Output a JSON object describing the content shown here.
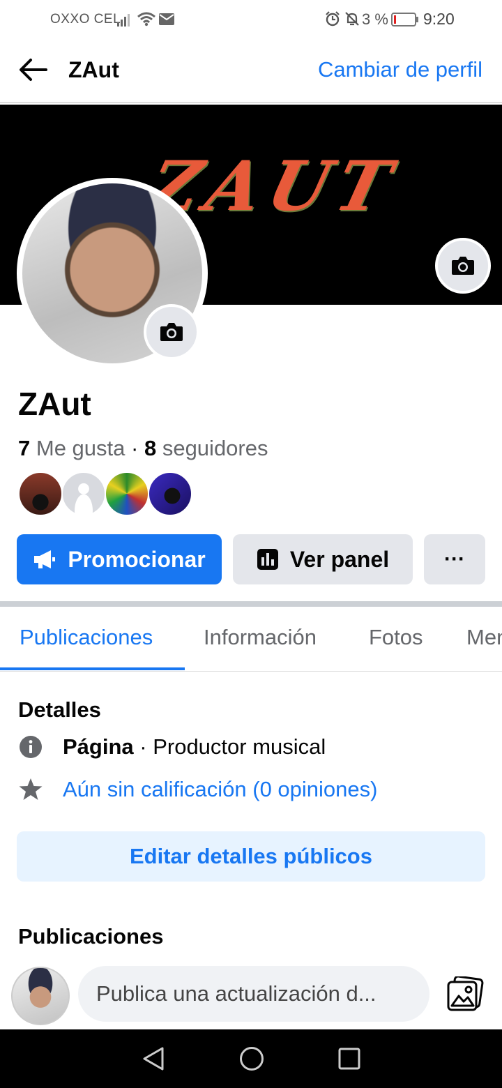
{
  "status_bar": {
    "carrier": "OXXO CEL",
    "battery": "3 %",
    "time": "9:20"
  },
  "header": {
    "title": "ZAut",
    "switch_profile": "Cambiar de perfil"
  },
  "cover": {
    "logo_text": "ZAUT"
  },
  "profile": {
    "name": "ZAut",
    "likes_count": "7",
    "likes_label": "Me gusta",
    "followers_count": "8",
    "followers_label": "seguidores"
  },
  "actions": {
    "promote": "Promocionar",
    "panel": "Ver panel",
    "more": "···"
  },
  "tabs": [
    {
      "label": "Publicaciones"
    },
    {
      "label": "Información"
    },
    {
      "label": "Fotos"
    },
    {
      "label": "Menciones"
    }
  ],
  "details": {
    "heading": "Detalles",
    "page_label": "Página",
    "page_category": " · Productor musical",
    "rating": "Aún sin calificación (0 opiniones)",
    "edit_button": "Editar detalles públicos"
  },
  "posts": {
    "heading": "Publicaciones",
    "composer_placeholder": "Publica una actualización d..."
  },
  "colors": {
    "accent": "#1877f2",
    "button_gray": "#e4e6eb",
    "edit_bg": "#e7f3ff"
  }
}
